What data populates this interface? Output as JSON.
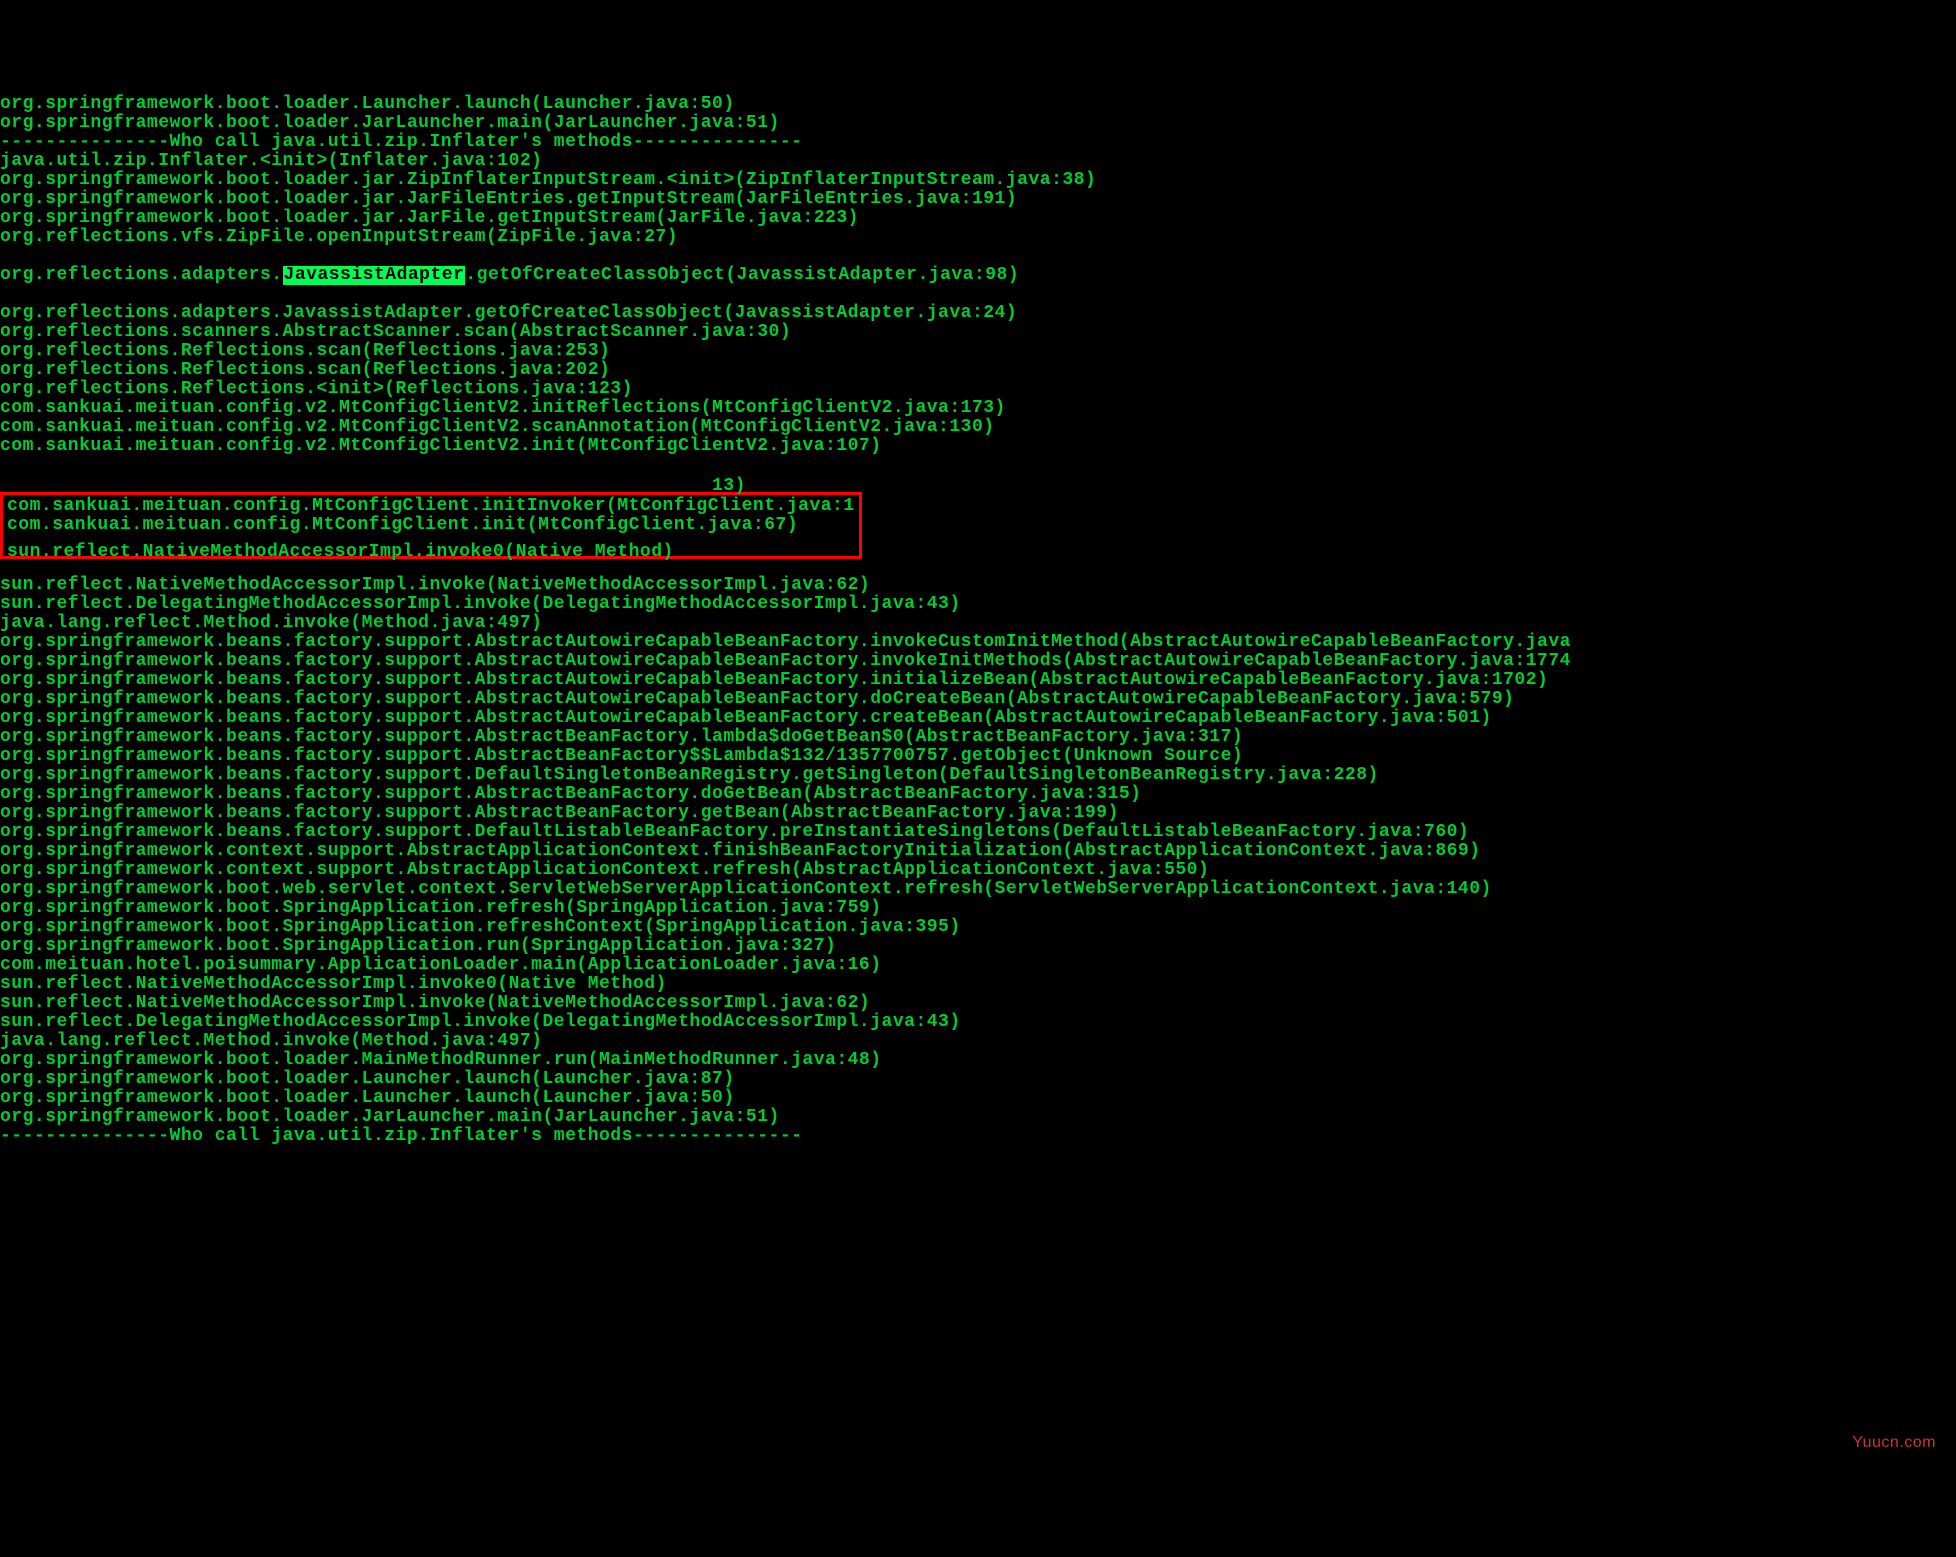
{
  "terminal": {
    "lines": [
      "org.springframework.boot.loader.Launcher.launch(Launcher.java:50)",
      "org.springframework.boot.loader.JarLauncher.main(JarLauncher.java:51)",
      "---------------Who call java.util.zip.Inflater's methods---------------",
      "java.util.zip.Inflater.<init>(Inflater.java:102)",
      "org.springframework.boot.loader.jar.ZipInflaterInputStream.<init>(ZipInflaterInputStream.java:38)",
      "org.springframework.boot.loader.jar.JarFileEntries.getInputStream(JarFileEntries.java:191)",
      "org.springframework.boot.loader.jar.JarFile.getInputStream(JarFile.java:223)",
      "org.reflections.vfs.ZipFile.openInputStream(ZipFile.java:27)"
    ],
    "highlight_line": {
      "pre": "org.reflections.adapters.",
      "hl": "JavassistAdapter",
      "post": ".getOfCreateClassObject(JavassistAdapter.java:98)"
    },
    "lines2": [
      "org.reflections.adapters.JavassistAdapter.getOfCreateClassObject(JavassistAdapter.java:24)",
      "org.reflections.scanners.AbstractScanner.scan(AbstractScanner.java:30)",
      "org.reflections.Reflections.scan(Reflections.java:253)",
      "org.reflections.Reflections.scan(Reflections.java:202)",
      "org.reflections.Reflections.<init>(Reflections.java:123)",
      "com.sankuai.meituan.config.v2.MtConfigClientV2.initReflections(MtConfigClientV2.java:173)",
      "com.sankuai.meituan.config.v2.MtConfigClientV2.scanAnnotation(MtConfigClientV2.java:130)",
      "com.sankuai.meituan.config.v2.MtConfigClientV2.init(MtConfigClientV2.java:107)"
    ],
    "boxed": {
      "line1": "com.sankuai.meituan.config.MtConfigClient.initInvoker(MtConfigClient.java:113)",
      "line2": "com.sankuai.meituan.config.MtConfigClient.init(MtConfigClient.java:67)",
      "line3_partial": "sun.reflect.NativeMethodAccessorImpl.invoke0(Native Method)"
    },
    "box_l1_inside": "com.sankuai.meituan.config.MtConfigClient.initInvoker(MtConfigClient.java:1",
    "box_l1_outside": "13)",
    "lines3": [
      "sun.reflect.NativeMethodAccessorImpl.invoke(NativeMethodAccessorImpl.java:62)",
      "sun.reflect.DelegatingMethodAccessorImpl.invoke(DelegatingMethodAccessorImpl.java:43)",
      "java.lang.reflect.Method.invoke(Method.java:497)",
      "org.springframework.beans.factory.support.AbstractAutowireCapableBeanFactory.invokeCustomInitMethod(AbstractAutowireCapableBeanFactory.java",
      "org.springframework.beans.factory.support.AbstractAutowireCapableBeanFactory.invokeInitMethods(AbstractAutowireCapableBeanFactory.java:1774",
      "org.springframework.beans.factory.support.AbstractAutowireCapableBeanFactory.initializeBean(AbstractAutowireCapableBeanFactory.java:1702)",
      "org.springframework.beans.factory.support.AbstractAutowireCapableBeanFactory.doCreateBean(AbstractAutowireCapableBeanFactory.java:579)",
      "org.springframework.beans.factory.support.AbstractAutowireCapableBeanFactory.createBean(AbstractAutowireCapableBeanFactory.java:501)",
      "org.springframework.beans.factory.support.AbstractBeanFactory.lambda$doGetBean$0(AbstractBeanFactory.java:317)",
      "org.springframework.beans.factory.support.AbstractBeanFactory$$Lambda$132/1357700757.getObject(Unknown Source)",
      "org.springframework.beans.factory.support.DefaultSingletonBeanRegistry.getSingleton(DefaultSingletonBeanRegistry.java:228)",
      "org.springframework.beans.factory.support.AbstractBeanFactory.doGetBean(AbstractBeanFactory.java:315)",
      "org.springframework.beans.factory.support.AbstractBeanFactory.getBean(AbstractBeanFactory.java:199)",
      "org.springframework.beans.factory.support.DefaultListableBeanFactory.preInstantiateSingletons(DefaultListableBeanFactory.java:760)",
      "org.springframework.context.support.AbstractApplicationContext.finishBeanFactoryInitialization(AbstractApplicationContext.java:869)",
      "org.springframework.context.support.AbstractApplicationContext.refresh(AbstractApplicationContext.java:550)",
      "org.springframework.boot.web.servlet.context.ServletWebServerApplicationContext.refresh(ServletWebServerApplicationContext.java:140)",
      "org.springframework.boot.SpringApplication.refresh(SpringApplication.java:759)",
      "org.springframework.boot.SpringApplication.refreshContext(SpringApplication.java:395)",
      "org.springframework.boot.SpringApplication.run(SpringApplication.java:327)",
      "com.meituan.hotel.poisummary.ApplicationLoader.main(ApplicationLoader.java:16)",
      "sun.reflect.NativeMethodAccessorImpl.invoke0(Native Method)",
      "sun.reflect.NativeMethodAccessorImpl.invoke(NativeMethodAccessorImpl.java:62)",
      "sun.reflect.DelegatingMethodAccessorImpl.invoke(DelegatingMethodAccessorImpl.java:43)",
      "java.lang.reflect.Method.invoke(Method.java:497)",
      "org.springframework.boot.loader.MainMethodRunner.run(MainMethodRunner.java:48)",
      "org.springframework.boot.loader.Launcher.launch(Launcher.java:87)",
      "org.springframework.boot.loader.Launcher.launch(Launcher.java:50)",
      "org.springframework.boot.loader.JarLauncher.main(JarLauncher.java:51)",
      "---------------Who call java.util.zip.Inflater's methods---------------"
    ]
  },
  "watermark": "Yuucn.com"
}
